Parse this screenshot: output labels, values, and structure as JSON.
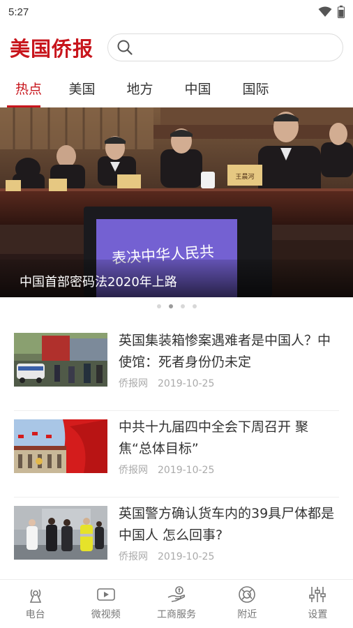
{
  "status_bar": {
    "time": "5:27"
  },
  "header": {
    "logo": "美国侨报",
    "search_placeholder": ""
  },
  "tabs": [
    {
      "label": "热点",
      "active": true
    },
    {
      "label": "美国",
      "active": false
    },
    {
      "label": "地方",
      "active": false
    },
    {
      "label": "中国",
      "active": false
    },
    {
      "label": "国际",
      "active": false
    }
  ],
  "banner": {
    "caption": "中国首部密码法2020年上路",
    "screen_text": "表决中华人民共",
    "nameplate_text": "王晨河",
    "slide_count": 4,
    "active_slide": 2
  },
  "news": [
    {
      "title": "英国集装箱惨案遇难者是中国人？中使馆：死者身份仍未定",
      "source": "侨报网",
      "date": "2019-10-25"
    },
    {
      "title": "中共十九届四中全会下周召开 聚焦“总体目标”",
      "source": "侨报网",
      "date": "2019-10-25"
    },
    {
      "title": "英国警方确认货车内的39具尸体都是中国人 怎么回事?",
      "source": "侨报网",
      "date": "2019-10-25"
    }
  ],
  "bottom_nav": [
    {
      "label": "电台",
      "icon": "radio-icon"
    },
    {
      "label": "微视频",
      "icon": "video-icon"
    },
    {
      "label": "工商服务",
      "icon": "business-service-icon"
    },
    {
      "label": "附近",
      "icon": "nearby-icon"
    },
    {
      "label": "设置",
      "icon": "settings-sliders-icon"
    }
  ],
  "colors": {
    "brand": "#c8161d",
    "text": "#333333",
    "meta": "#aaaaaa"
  }
}
